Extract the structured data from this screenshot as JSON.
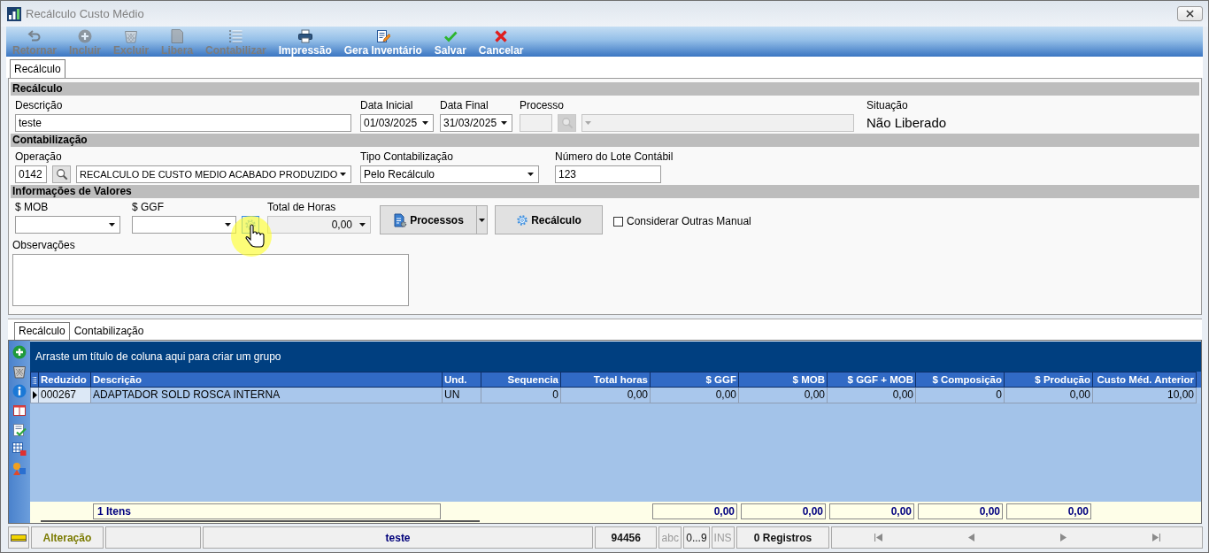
{
  "window": {
    "title": "Recálculo Custo Médio"
  },
  "toolbar": [
    {
      "label": "Retornar",
      "disabled": true
    },
    {
      "label": "Incluir",
      "disabled": true
    },
    {
      "label": "Excluir",
      "disabled": true
    },
    {
      "label": "Libera",
      "disabled": true
    },
    {
      "label": "Contabilizar",
      "disabled": true
    },
    {
      "label": "Impressão",
      "disabled": false
    },
    {
      "label": "Gera Inventário",
      "disabled": false
    },
    {
      "label": "Salvar",
      "disabled": false
    },
    {
      "label": "Cancelar",
      "disabled": false
    }
  ],
  "tabs": [
    {
      "label": "Recálculo",
      "selected": true
    }
  ],
  "recalculo": {
    "header": "Recálculo",
    "descricao": {
      "label": "Descrição",
      "value": "teste"
    },
    "data_inicial": {
      "label": "Data Inicial",
      "value": "01/03/2025"
    },
    "data_final": {
      "label": "Data Final",
      "value": "31/03/2025"
    },
    "processo": {
      "label": "Processo",
      "disabled": true
    },
    "situacao": {
      "label": "Situação",
      "value": "Não Liberado"
    }
  },
  "contabilizacao": {
    "header": "Contabilização",
    "operacao": {
      "label": "Operação",
      "code": "0142",
      "value": "RECALCULO DE CUSTO MEDIO ACABADO PRODUZIDO"
    },
    "tipo": {
      "label": "Tipo Contabilização",
      "value": "Pelo Recálculo"
    },
    "lote": {
      "label": "Número do Lote Contábil",
      "value": "123"
    }
  },
  "valores": {
    "header": "Informações de Valores",
    "mob": {
      "label": "$ MOB"
    },
    "ggf": {
      "label": "$ GGF"
    },
    "total_horas": {
      "label": "Total de Horas",
      "value": "0,00",
      "disabled": true
    },
    "processos_button": "Processos",
    "recalculo_button": "Recálculo",
    "considerar": {
      "label": "Considerar Outras Manual",
      "checked": false
    },
    "observacoes": {
      "label": "Observações"
    }
  },
  "detail_tabs": [
    {
      "label": "Recálculo",
      "selected": true
    },
    {
      "label": "Contabilização",
      "selected": false
    }
  ],
  "grid": {
    "group_hint": "Arraste um título de coluna aqui para criar um grupo",
    "columns": [
      {
        "label": "Reduzido",
        "kind": "text"
      },
      {
        "label": "Descrição",
        "kind": "text"
      },
      {
        "label": "Und.",
        "kind": "text"
      },
      {
        "label": "Sequencia",
        "kind": "number"
      },
      {
        "label": "Total horas",
        "kind": "number"
      },
      {
        "label": "$ GGF",
        "kind": "number"
      },
      {
        "label": "$ MOB",
        "kind": "number"
      },
      {
        "label": "$ GGF + MOB",
        "kind": "number"
      },
      {
        "label": "$ Composição",
        "kind": "number"
      },
      {
        "label": "$ Produção",
        "kind": "number"
      },
      {
        "label": "Custo Méd. Anterior",
        "kind": "number"
      }
    ],
    "rows": [
      {
        "selected": true,
        "cells": [
          "000267",
          "ADAPTADOR SOLD ROSCA INTERNA",
          "UN",
          "0",
          "0,00",
          "0,00",
          "0,00",
          "0,00",
          "0",
          "0,00",
          "10,00"
        ]
      }
    ],
    "footer": {
      "count": "1 Itens",
      "totals": [
        "0,00",
        "0,00",
        "0,00",
        "0,00",
        "0,00"
      ]
    }
  },
  "status_bar": {
    "mode": "Alteração",
    "description": "teste",
    "code": "94456",
    "indicators": [
      {
        "label": "abc",
        "on": false
      },
      {
        "label": "0...9",
        "on": true
      },
      {
        "label": "INS",
        "on": false
      }
    ],
    "records": "0 Registros"
  }
}
